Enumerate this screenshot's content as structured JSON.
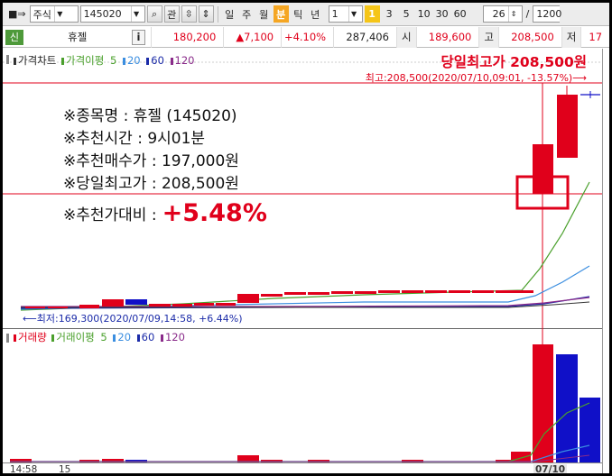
{
  "toolbar": {
    "market_select": "주식",
    "code": "145020",
    "btn_related": "관",
    "periods": [
      "일",
      "주",
      "월",
      "분",
      "틱",
      "년"
    ],
    "active_period": "분",
    "interval_value": "1",
    "interval_active": "1",
    "minute_options": [
      "3",
      "5",
      "10",
      "30",
      "60"
    ],
    "count": "26",
    "count_sep": "/",
    "count_total": "1200"
  },
  "quote": {
    "badge": "신",
    "name": "휴젤",
    "info_btn": "i",
    "price": "180,200",
    "change": "▲7,100",
    "change_pct": "+4.10%",
    "volume": "287,406",
    "open_label": "시",
    "open": "189,600",
    "high_label": "고",
    "high": "208,500",
    "low_label": "저",
    "low": "17"
  },
  "price_pane": {
    "legend_title": "가격차트",
    "legend_ma_title": "가격이평",
    "ma_periods": [
      "5",
      "20",
      "60",
      "120"
    ],
    "headline": "당일최고가 208,500원",
    "high_note": "최고:208,500(2020/07/10,09:01, -13.57%)⟶",
    "low_note": "⟵최저:169,300(2020/07/09,14:58, +6.44%)"
  },
  "info": {
    "line1": "※종목명 : 휴젤 (145020)",
    "line2": "※추천시간 : 9시01분",
    "line3": "※추천매수가 : 197,000원",
    "line4": "※당일최고가 : 208,500원",
    "pct_label": "※추천가대비 :",
    "pct_value": "+5.48%"
  },
  "volume_pane": {
    "legend_title": "거래량",
    "legend_ma_title": "거래이평",
    "ma_periods": [
      "5",
      "20",
      "60",
      "120"
    ]
  },
  "xaxis": {
    "labels": [
      "14:58",
      "15",
      "07/10"
    ]
  },
  "colors": {
    "up": "#e0001b",
    "down": "#1010c8",
    "ma5": "#4aa02c",
    "ma20": "#3b8ee0",
    "ma60": "#1b2ba8",
    "ma120": "#8a2b8a"
  }
}
